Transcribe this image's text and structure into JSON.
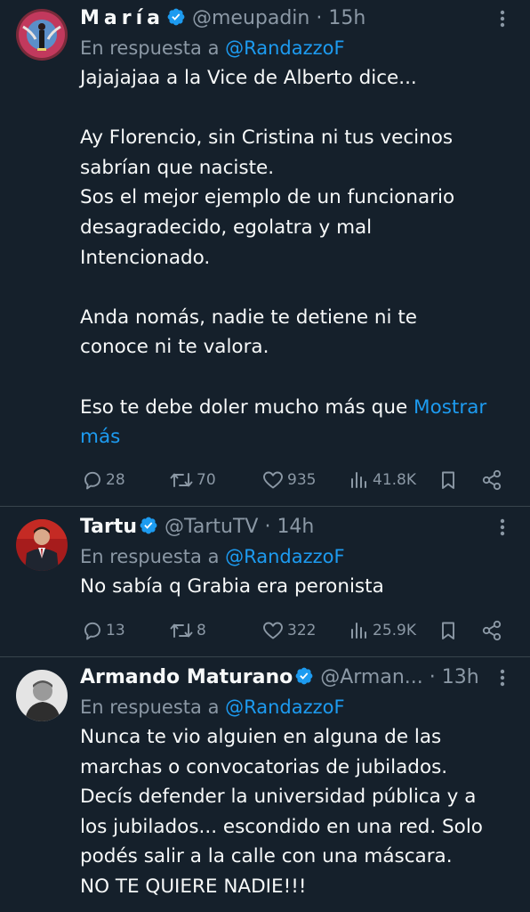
{
  "tweets": [
    {
      "name": "María",
      "handle": "@meupadin",
      "dot": "·",
      "time": "15h",
      "reply_prefix": "En respuesta a ",
      "reply_to": "@RandazzoF",
      "text": "Jajajajaa a la Vice de Alberto dice...\n\nAy Florencio, sin Cristina ni tus vecinos\nsabrían que naciste.\nSos el mejor ejemplo de un funcionario\ndesagradecido, egolatra y mal\nIntencionado.\n\nAnda nomás, nadie te detiene ni te\nconoce ni te valora.\n\nEso te debe doler mucho más que ",
      "show_more": "Mostrar\nmás",
      "replies": "28",
      "retweets": "70",
      "likes": "935",
      "views": "41.8K"
    },
    {
      "name": "Tartu",
      "handle": "@TartuTV",
      "dot": "·",
      "time": "14h",
      "reply_prefix": "En respuesta a ",
      "reply_to": "@RandazzoF",
      "text": "No sabía q Grabia era peronista",
      "replies": "13",
      "retweets": "8",
      "likes": "322",
      "views": "25.9K"
    },
    {
      "name": "Armando Maturano",
      "handle": "@Arman...",
      "dot": "·",
      "time": "13h",
      "reply_prefix": "En respuesta a ",
      "reply_to": "@RandazzoF",
      "text": "Nunca te vio alguien en alguna de las\nmarchas o convocatorias de jubilados.\nDecís defender la universidad pública y a\nlos jubilados... escondido en una red. Solo\npodés salir a la calle con una máscara.\nNO TE QUIERE NADIE!!!"
    }
  ],
  "colors": {
    "background": "#15202b",
    "text": "#f7f9f9",
    "muted": "#8b98a5",
    "link": "#1d9bf0",
    "divider": "#38444d"
  },
  "icons": [
    "verified-badge-icon",
    "more-icon",
    "reply-icon",
    "retweet-icon",
    "like-icon",
    "views-icon",
    "bookmark-icon",
    "share-icon"
  ]
}
